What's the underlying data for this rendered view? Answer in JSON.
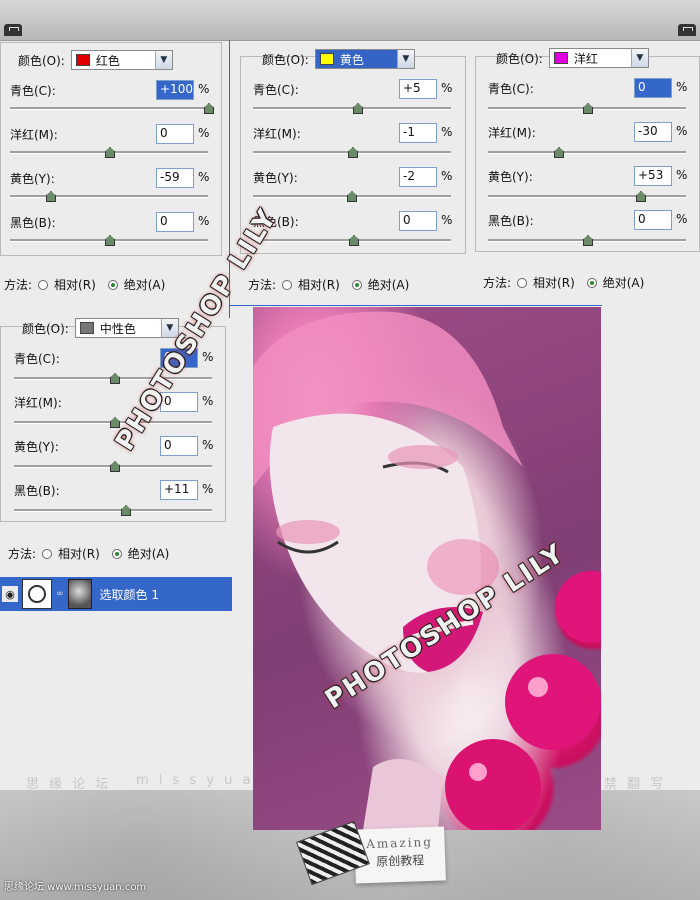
{
  "panels": [
    {
      "color_label": "颜色(O):",
      "color_value": "红色",
      "swatch": "#e00000",
      "active": false,
      "fields": [
        {
          "label": "青色(C):",
          "value": "+100",
          "selected": true,
          "slider_pct": 100
        },
        {
          "label": "洋红(M):",
          "value": "0",
          "selected": false,
          "slider_pct": 50
        },
        {
          "label": "黄色(Y):",
          "value": "-59",
          "selected": false,
          "slider_pct": 20
        },
        {
          "label": "黑色(B):",
          "value": "0",
          "selected": false,
          "slider_pct": 50
        }
      ],
      "method_label": "方法:",
      "relative": "相对(R)",
      "absolute": "绝对(A)"
    },
    {
      "color_label": "颜色(O):",
      "color_value": "黄色",
      "swatch": "#ffff00",
      "active": true,
      "fields": [
        {
          "label": "青色(C):",
          "value": "+5",
          "selected": false,
          "slider_pct": 52
        },
        {
          "label": "洋红(M):",
          "value": "-1",
          "selected": false,
          "slider_pct": 50
        },
        {
          "label": "黄色(Y):",
          "value": "-2",
          "selected": false,
          "slider_pct": 49
        },
        {
          "label": "黑色(B):",
          "value": "0",
          "selected": false,
          "slider_pct": 50
        }
      ],
      "method_label": "方法:",
      "relative": "相对(R)",
      "absolute": "绝对(A)"
    },
    {
      "color_label": "颜色(O):",
      "color_value": "洋红",
      "swatch": "#e000e0",
      "active": false,
      "fields": [
        {
          "label": "青色(C):",
          "value": "0",
          "selected": true,
          "slider_pct": 50
        },
        {
          "label": "洋红(M):",
          "value": "-30",
          "selected": false,
          "slider_pct": 35
        },
        {
          "label": "黄色(Y):",
          "value": "+53",
          "selected": false,
          "slider_pct": 77
        },
        {
          "label": "黑色(B):",
          "value": "0",
          "selected": false,
          "slider_pct": 50
        }
      ],
      "method_label": "方法:",
      "relative": "相对(R)",
      "absolute": "绝对(A)"
    },
    {
      "color_label": "颜色(O):",
      "color_value": "中性色",
      "swatch": "#777777",
      "active": false,
      "fields": [
        {
          "label": "青色(C):",
          "value": "0",
          "selected": true,
          "slider_pct": 50
        },
        {
          "label": "洋红(M):",
          "value": "0",
          "selected": false,
          "slider_pct": 50
        },
        {
          "label": "黄色(Y):",
          "value": "0",
          "selected": false,
          "slider_pct": 50
        },
        {
          "label": "黑色(B):",
          "value": "+11",
          "selected": false,
          "slider_pct": 55
        }
      ],
      "method_label": "方法:",
      "relative": "相对(R)",
      "absolute": "绝对(A)"
    }
  ],
  "percent_sign": "%",
  "layer": {
    "name": "选取颜色 1"
  },
  "watermark": {
    "stamp": "PHOTOSHOP LILY",
    "forum_left": "思 缘 论 坛",
    "site_mid": "m i s s y u a n .",
    "right_text": "禁 翻 写"
  },
  "badge": {
    "line1": "Amazing",
    "line2": "原创教程"
  },
  "footer": "思缘论坛 www.missyuan.com",
  "icons": {
    "visibility": "eye-icon",
    "corner": "dialog-corner-icon"
  }
}
